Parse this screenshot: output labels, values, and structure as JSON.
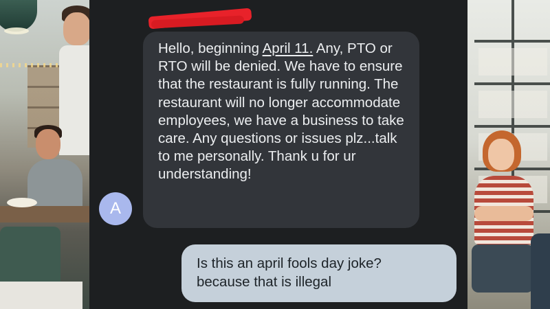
{
  "conversation": {
    "sender_avatar_letter": "A",
    "incoming_message": {
      "before_date": "Hello, beginning ",
      "date": "April 11.",
      "after_date": " Any, PTO or RTO will be denied. We have to ensure that the restaurant is fully running. The restaurant will no longer accommodate employees, we have a business to take care. Any questions or issues plz...talk to me personally. Thank u for ur understanding!"
    },
    "outgoing_message": {
      "line1": "Is this an april fools day joke?",
      "line2": "because that is illegal"
    }
  },
  "colors": {
    "chat_background": "#1d1f21",
    "incoming_bubble": "#32353a",
    "outgoing_bubble": "#c5d0da",
    "avatar": "#a9b8ed",
    "redaction": "#e8222a"
  }
}
